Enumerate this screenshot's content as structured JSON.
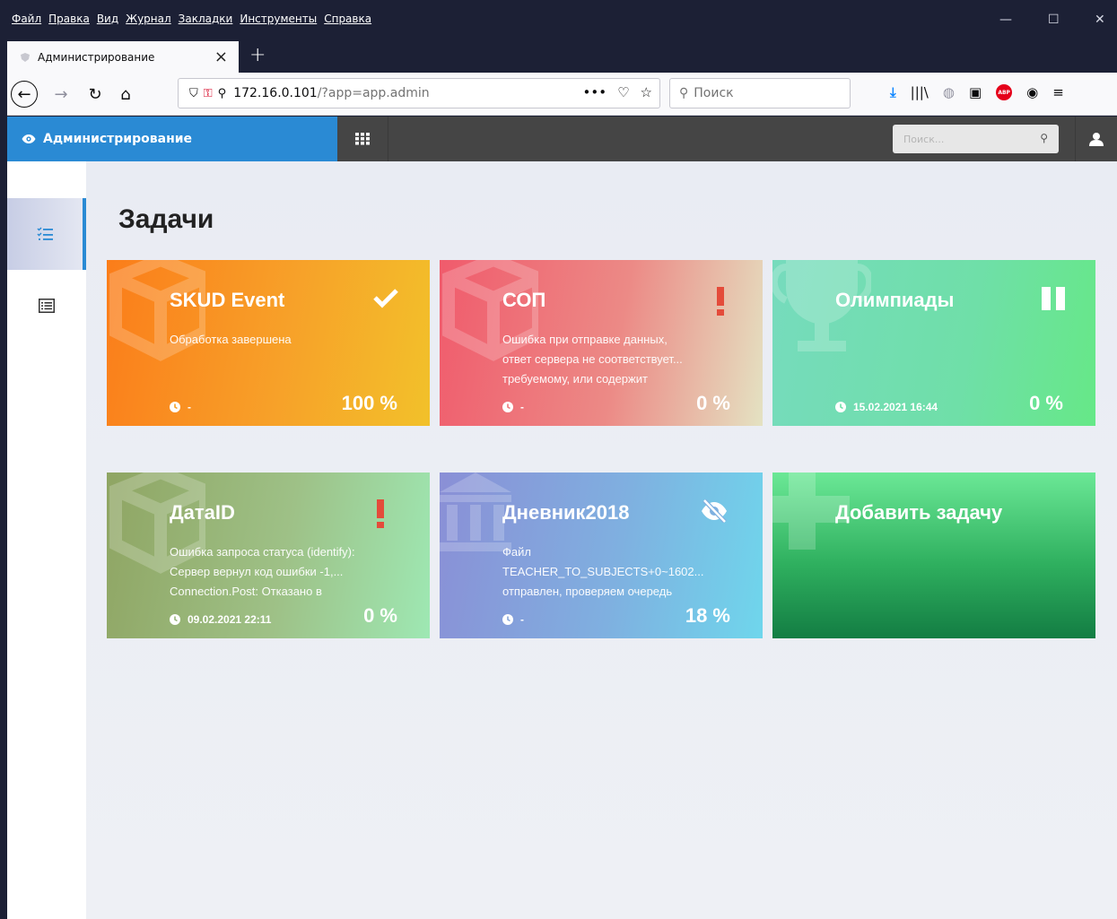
{
  "browser": {
    "menu": [
      "Файл",
      "Правка",
      "Вид",
      "Журнал",
      "Закладки",
      "Инструменты",
      "Справка"
    ],
    "tab_title": "Администрирование",
    "url_host": "172.16.0.101",
    "url_path": "/?app=app.admin",
    "search_placeholder": "Поиск"
  },
  "app": {
    "brand": "Администрирование",
    "search_placeholder": "Поиск...",
    "accent": "#2a8ad4"
  },
  "page": {
    "title": "Задачи"
  },
  "cards": [
    {
      "title": "SKUD Event",
      "status_icon": "check-icon",
      "description": [
        "Обработка завершена"
      ],
      "time": "-",
      "percent": "100 %"
    },
    {
      "title": "СОП",
      "status_icon": "exclamation-icon",
      "description": [
        "Ошибка при отправке данных,",
        "ответ сервера не соответствует...",
        "требуемому, или содержит"
      ],
      "time": "-",
      "percent": "0 %"
    },
    {
      "title": "Олимпиады",
      "status_icon": "pause-icon",
      "description": [],
      "time": "15.02.2021 16:44",
      "percent": "0 %"
    },
    {
      "title": "ДатаID",
      "status_icon": "exclamation-icon",
      "description": [
        "Ошибка запроса статуса (identify):",
        "Сервер вернул код ошибки -1,...",
        "Connection.Post: Отказано в"
      ],
      "time": "09.02.2021 22:11",
      "percent": "0 %"
    },
    {
      "title": "Дневник2018",
      "status_icon": "eye-slash-icon",
      "description": [
        "Файл",
        "TEACHER_TO_SUBJECTS+0~1602...",
        "отправлен, проверяем очередь"
      ],
      "time": "-",
      "percent": "18 %"
    },
    {
      "title": "Добавить задачу"
    }
  ]
}
